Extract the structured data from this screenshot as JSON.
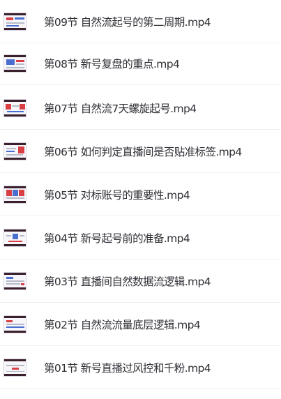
{
  "files": [
    {
      "name": "第09节 自然流起号的第二周期.mp4",
      "thumb_icon": "video-thumbnail-icon"
    },
    {
      "name": "第08节 新号复盘的重点.mp4",
      "thumb_icon": "video-thumbnail-icon"
    },
    {
      "name": "第07节 自然流7天螺旋起号.mp4",
      "thumb_icon": "video-thumbnail-icon"
    },
    {
      "name": "第06节 如何判定直播间是否贴准标签.mp4",
      "thumb_icon": "video-thumbnail-icon"
    },
    {
      "name": "第05节 对标账号的重要性.mp4",
      "thumb_icon": "video-thumbnail-icon"
    },
    {
      "name": "第04节 新号起号前的准备.mp4",
      "thumb_icon": "video-thumbnail-icon"
    },
    {
      "name": "第03节 直播间自然数据流逻辑.mp4",
      "thumb_icon": "video-thumbnail-icon"
    },
    {
      "name": "第02节 自然流流量底层逻辑.mp4",
      "thumb_icon": "video-thumbnail-icon"
    },
    {
      "name": "第01节 新号直播过风控和千粉.mp4",
      "thumb_icon": "video-thumbnail-icon"
    }
  ]
}
